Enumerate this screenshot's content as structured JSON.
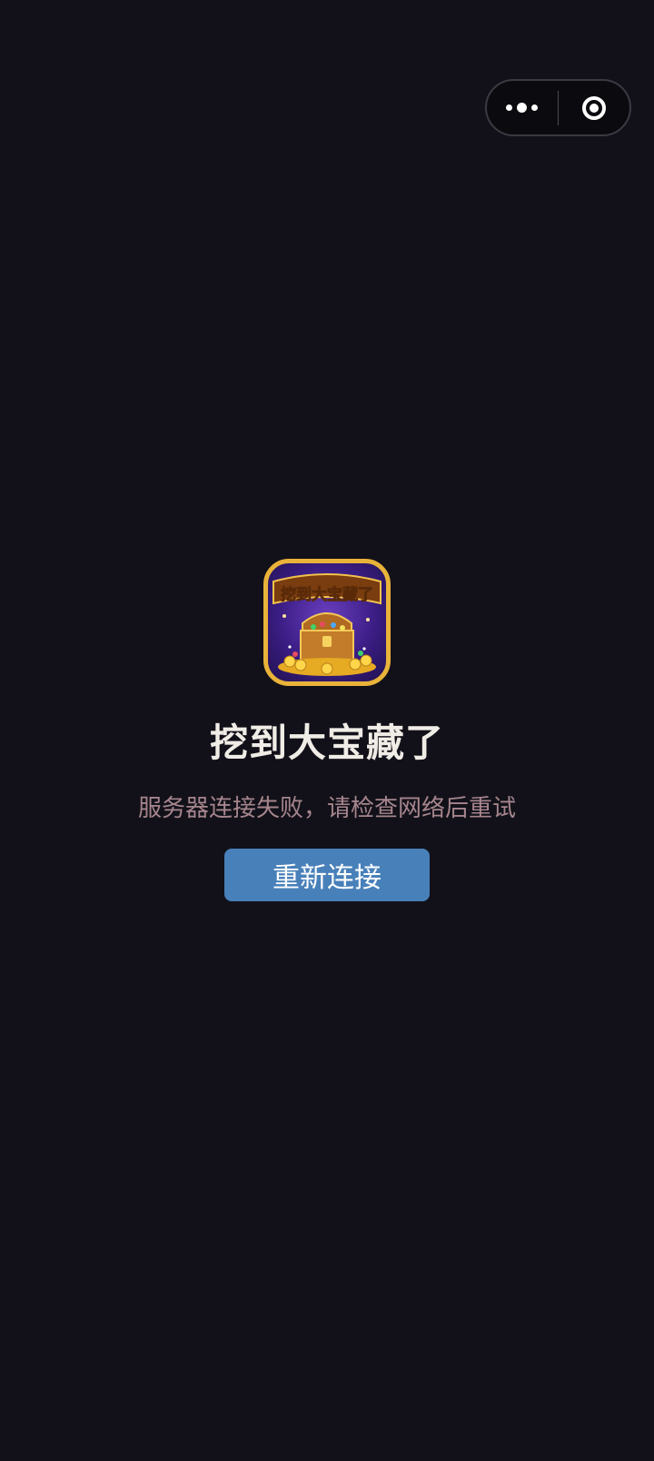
{
  "capsule": {
    "more_icon": "more-dots-icon",
    "close_icon": "target-close-icon"
  },
  "app": {
    "icon": "treasure-chest-icon",
    "icon_banner_text": "挖到大宝藏了",
    "name": "挖到大宝藏了"
  },
  "error": {
    "message": "服务器连接失败，请检查网络后重试"
  },
  "retry": {
    "label": "重新连接"
  },
  "colors": {
    "background": "#121119",
    "accent_button": "#4880b9",
    "error_text": "#a6858d",
    "title_text": "#f0ece6",
    "icon_border": "#e9b33a"
  }
}
